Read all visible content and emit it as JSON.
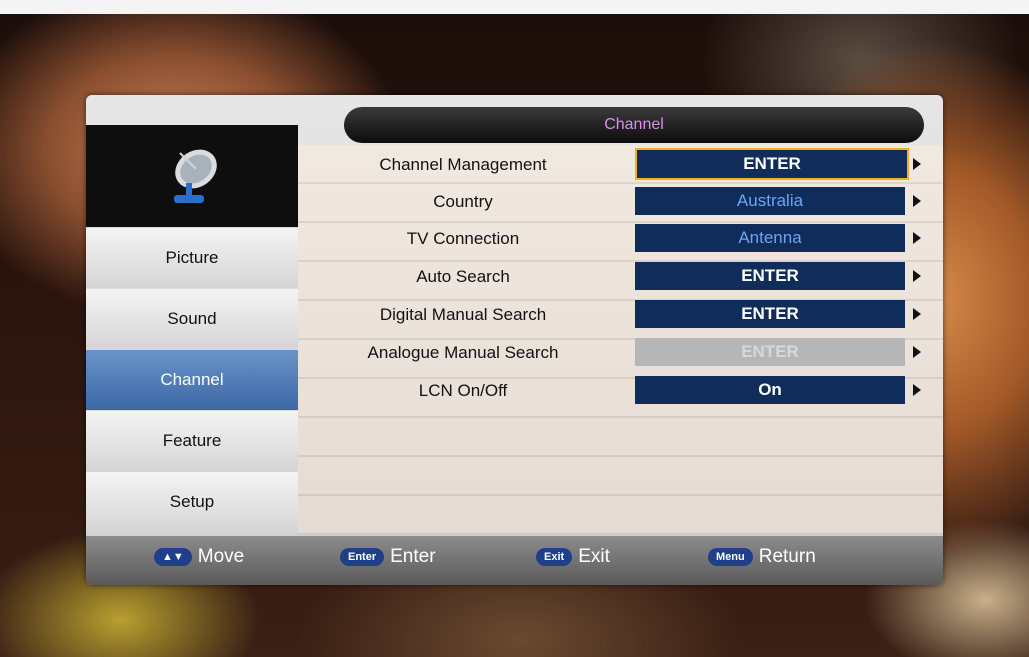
{
  "menu": {
    "title": "Channel",
    "sidebar": [
      {
        "label": "Picture",
        "active": false
      },
      {
        "label": "Sound",
        "active": false
      },
      {
        "label": "Channel",
        "active": true
      },
      {
        "label": "Feature",
        "active": false
      },
      {
        "label": "Setup",
        "active": false
      }
    ],
    "rows": [
      {
        "label": "Channel Management",
        "value": "ENTER",
        "state": "selected"
      },
      {
        "label": "Country",
        "value": "Australia",
        "state": "normal"
      },
      {
        "label": "TV Connection",
        "value": "Antenna",
        "state": "normal"
      },
      {
        "label": "Auto Search",
        "value": "ENTER",
        "state": "emphasis"
      },
      {
        "label": "Digital Manual Search",
        "value": "ENTER",
        "state": "emphasis"
      },
      {
        "label": "Analogue Manual Search",
        "value": "ENTER",
        "state": "disabled"
      },
      {
        "label": "LCN On/Off",
        "value": "On",
        "state": "emphasis"
      }
    ]
  },
  "footer": {
    "move": {
      "key": "▲▼",
      "label": "Move"
    },
    "enter": {
      "key": "Enter",
      "label": "Enter"
    },
    "exit": {
      "key": "Exit",
      "label": "Exit"
    },
    "return": {
      "key": "Menu",
      "label": "Return"
    }
  },
  "icons": {
    "category_icon": "satellite-dish-icon"
  }
}
